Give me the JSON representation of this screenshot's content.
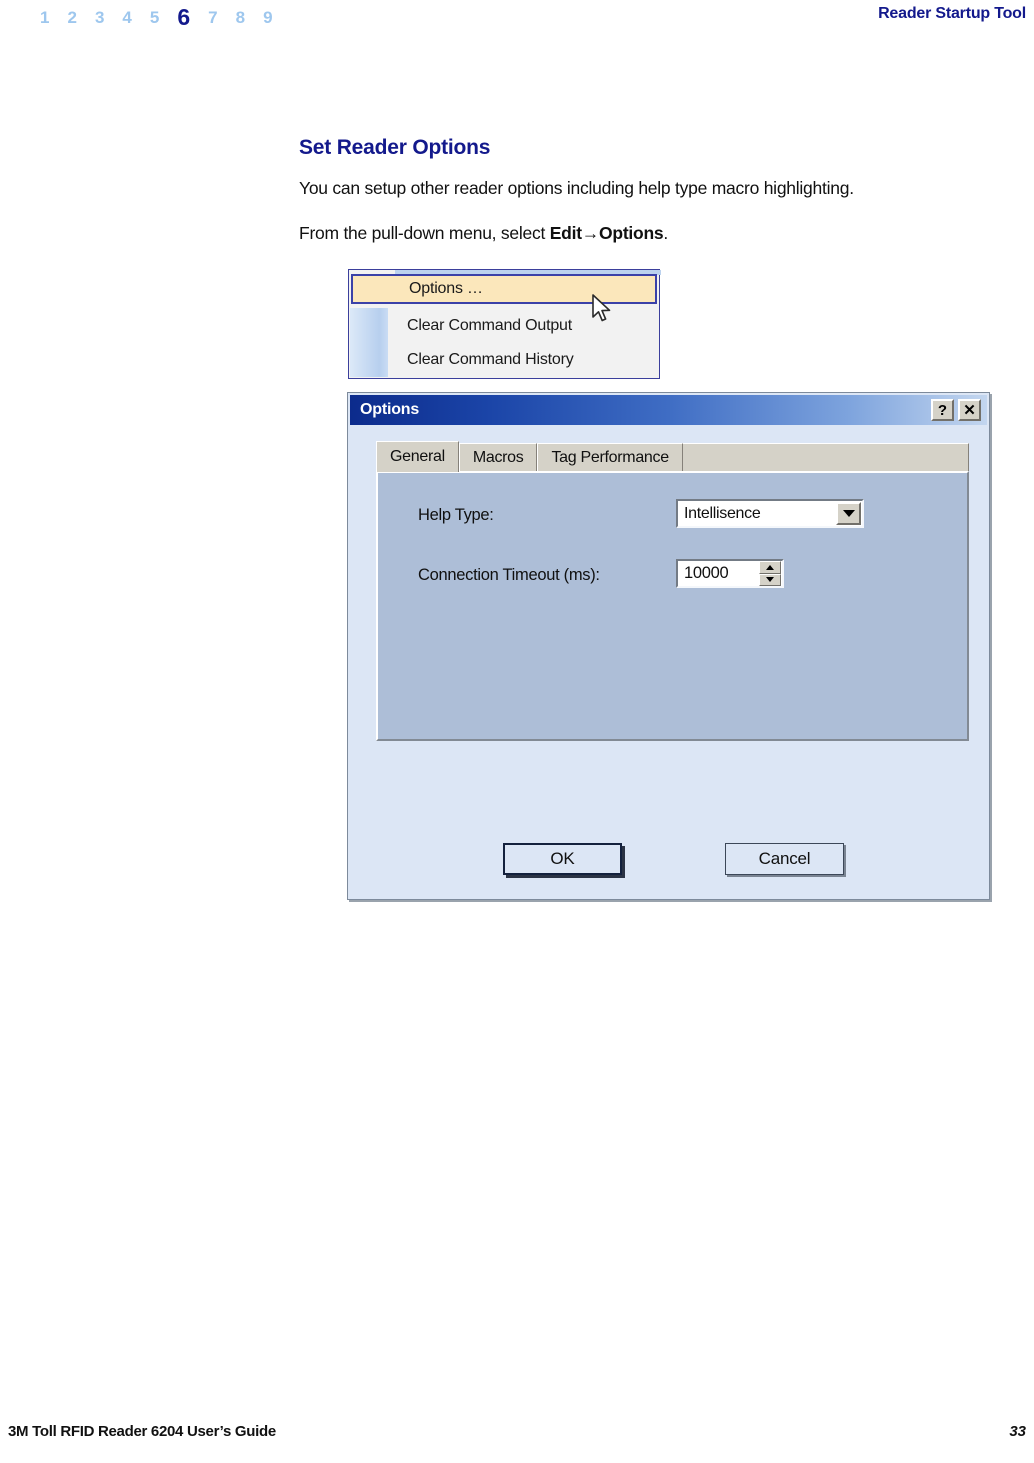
{
  "header": {
    "chapter_numbers": [
      "1",
      "2",
      "3",
      "4",
      "5",
      "6",
      "7",
      "8",
      "9"
    ],
    "current_chapter": "6",
    "title": "Reader Startup Tool",
    "accent_color": "#13198c",
    "inactive_color": "#9ec7ee"
  },
  "content": {
    "section_title": "Set Reader Options",
    "paragraph_1": "You can setup other reader options including help type macro highlighting.",
    "paragraph_2_prefix": "From the pull-down menu, select ",
    "paragraph_2_bold": "Edit→Options",
    "paragraph_2_suffix": "."
  },
  "menu_figure": {
    "items": [
      {
        "label": "Options …",
        "selected": true
      },
      {
        "label": "Clear Command Output",
        "selected": false
      },
      {
        "label": "Clear Command History",
        "selected": false
      }
    ],
    "highlight_bg": "#fbe7bb",
    "highlight_border": "#3b41a8",
    "cursor": "arrow-cursor"
  },
  "dialog": {
    "title": "Options",
    "help_button": "?",
    "close_button": "✕",
    "tabs": [
      {
        "label": "General",
        "active": true
      },
      {
        "label": "Macros",
        "active": false
      },
      {
        "label": "Tag Performance",
        "active": false
      }
    ],
    "fields": {
      "help_type_label": "Help Type:",
      "help_type_value": "Intellisence",
      "timeout_label": "Connection Timeout (ms):",
      "timeout_value": "10000"
    },
    "buttons": {
      "ok": "OK",
      "cancel": "Cancel"
    },
    "titlebar_start_color": "#0c2b8c",
    "titlebar_end_color": "#c3d6ef",
    "panel_color": "#adbed7",
    "body_color": "#dce6f5"
  },
  "footer": {
    "document_title": "3M Toll RFID Reader 6204 User’s Guide",
    "page_number": "33"
  }
}
